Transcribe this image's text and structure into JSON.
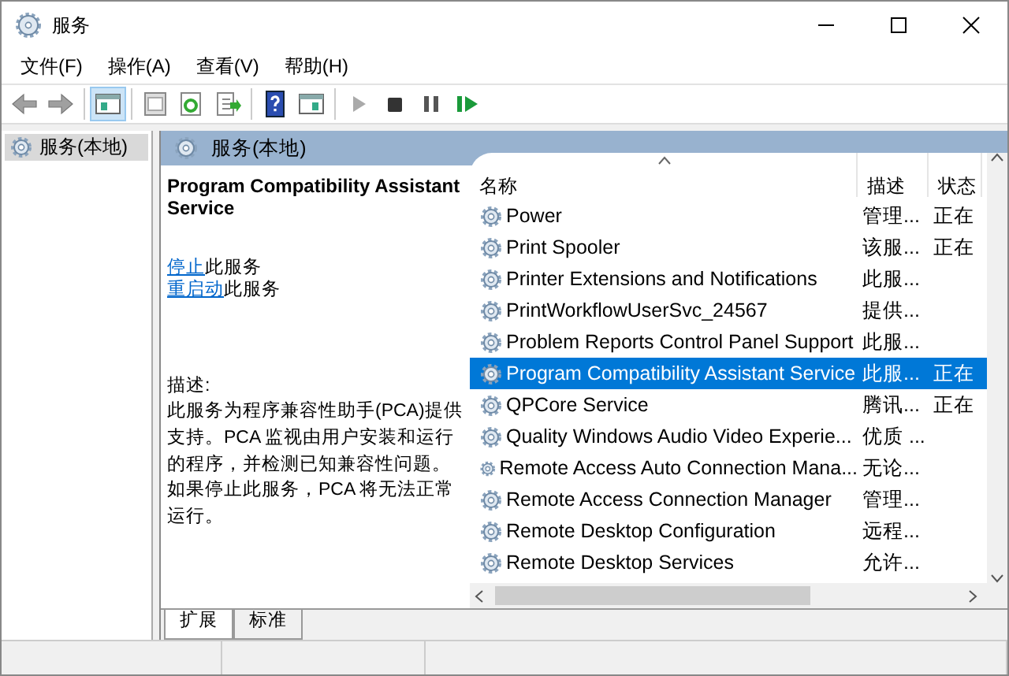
{
  "window": {
    "title": "服务"
  },
  "menu": [
    "文件(F)",
    "操作(A)",
    "查看(V)",
    "帮助(H)"
  ],
  "toolbar": [
    {
      "kind": "back",
      "disabled": false,
      "selected": false
    },
    {
      "kind": "forward",
      "disabled": false,
      "selected": false
    },
    {
      "kind": "sep"
    },
    {
      "kind": "tree",
      "disabled": false,
      "selected": true
    },
    {
      "kind": "sep"
    },
    {
      "kind": "properties",
      "disabled": false,
      "selected": false
    },
    {
      "kind": "refresh",
      "disabled": false,
      "selected": false
    },
    {
      "kind": "export",
      "disabled": false,
      "selected": false
    },
    {
      "kind": "sep"
    },
    {
      "kind": "help",
      "disabled": false,
      "selected": false
    },
    {
      "kind": "view",
      "disabled": false,
      "selected": false
    },
    {
      "kind": "sep"
    },
    {
      "kind": "start",
      "disabled": true,
      "selected": false
    },
    {
      "kind": "stop",
      "disabled": false,
      "selected": false
    },
    {
      "kind": "pause",
      "disabled": false,
      "selected": false
    },
    {
      "kind": "resume",
      "disabled": false,
      "selected": false
    }
  ],
  "tree": [
    {
      "label": "服务(本地)",
      "selected": true
    }
  ],
  "header": "服务(本地)",
  "detail": {
    "title": "Program Compatibility Assistant Service",
    "actions": [
      {
        "link": "停止",
        "text": "此服务"
      },
      {
        "link": "重启动",
        "text": "此服务"
      }
    ],
    "description_label": "描述:",
    "description": "此服务为程序兼容性助手(PCA)提供支持。PCA 监视由用户安装和运行的程序，并检测已知兼容性问题。如果停止此服务，PCA 将无法正常运行。"
  },
  "table": {
    "columns": [
      {
        "label": "名称",
        "sorted": true
      },
      {
        "label": "描述",
        "sorted": false
      },
      {
        "label": "状态",
        "sorted": false
      }
    ],
    "rows": [
      {
        "name": "Power",
        "description": "管理...",
        "status": "正在",
        "selected": false
      },
      {
        "name": "Print Spooler",
        "description": "该服...",
        "status": "正在",
        "selected": false
      },
      {
        "name": "Printer Extensions and Notifications",
        "description": "此服...",
        "status": "",
        "selected": false
      },
      {
        "name": "PrintWorkflowUserSvc_24567",
        "description": "提供...",
        "status": "",
        "selected": false
      },
      {
        "name": "Problem Reports Control Panel Support",
        "description": "此服...",
        "status": "",
        "selected": false
      },
      {
        "name": "Program Compatibility Assistant Service",
        "description": "此服...",
        "status": "正在",
        "selected": true
      },
      {
        "name": "QPCore Service",
        "description": "腾讯...",
        "status": "正在",
        "selected": false
      },
      {
        "name": "Quality Windows Audio Video Experie...",
        "description": "优质 ...",
        "status": "",
        "selected": false
      },
      {
        "name": "Remote Access Auto Connection Mana...",
        "description": "无论...",
        "status": "",
        "selected": false
      },
      {
        "name": "Remote Access Connection Manager",
        "description": "管理...",
        "status": "",
        "selected": false
      },
      {
        "name": "Remote Desktop Configuration",
        "description": "远程...",
        "status": "",
        "selected": false
      },
      {
        "name": "Remote Desktop Services",
        "description": "允许...",
        "status": "",
        "selected": false
      }
    ]
  },
  "tabs": [
    {
      "label": "扩展",
      "selected": true
    },
    {
      "label": "标准",
      "selected": false
    }
  ]
}
